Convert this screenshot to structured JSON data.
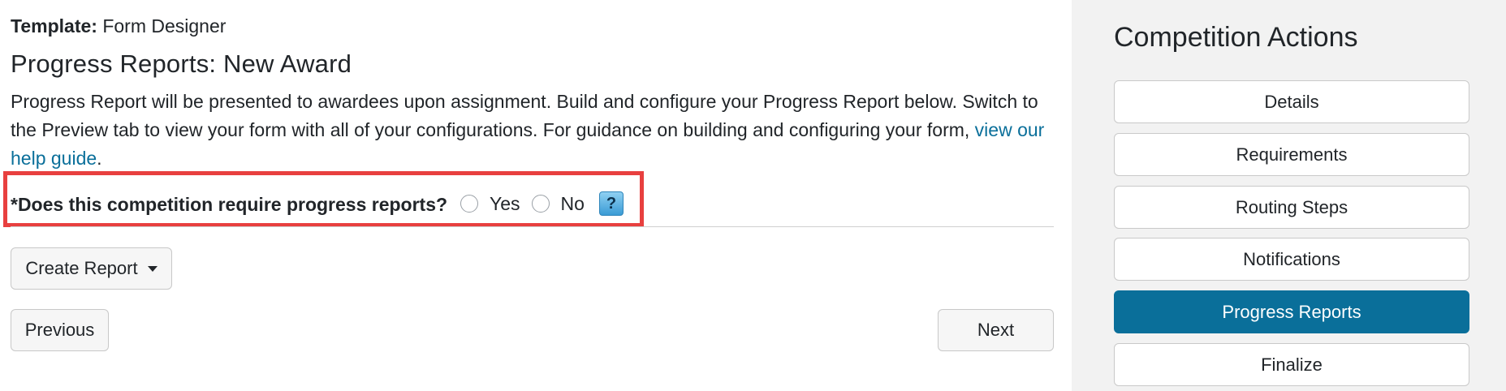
{
  "header": {
    "template_label": "Template:",
    "template_value": "Form Designer",
    "page_title": "Progress Reports: New Award",
    "description_text": "Progress Report will be presented to awardees upon assignment. Build and configure your Progress Report below. Switch to the Preview tab to view your form with all of your configurations. For guidance on building and configuring your form, ",
    "description_link": "view our help guide",
    "description_end": "."
  },
  "question": {
    "label": "*Does this competition require progress reports?",
    "options": [
      "Yes",
      "No"
    ],
    "selected": null,
    "help_symbol": "?"
  },
  "actions": {
    "create_report": "Create Report",
    "previous": "Previous",
    "next": "Next"
  },
  "sidebar": {
    "title": "Competition Actions",
    "items": [
      {
        "label": "Details",
        "active": false
      },
      {
        "label": "Requirements",
        "active": false
      },
      {
        "label": "Routing Steps",
        "active": false
      },
      {
        "label": "Notifications",
        "active": false
      },
      {
        "label": "Progress Reports",
        "active": true
      },
      {
        "label": "Finalize",
        "active": false
      }
    ]
  },
  "colors": {
    "accent": "#0a6f9a",
    "highlight_border": "#e8403f",
    "sidebar_bg": "#f2f2f2"
  },
  "icons": {
    "help": "question-icon",
    "dropdown": "caret-down-icon"
  }
}
